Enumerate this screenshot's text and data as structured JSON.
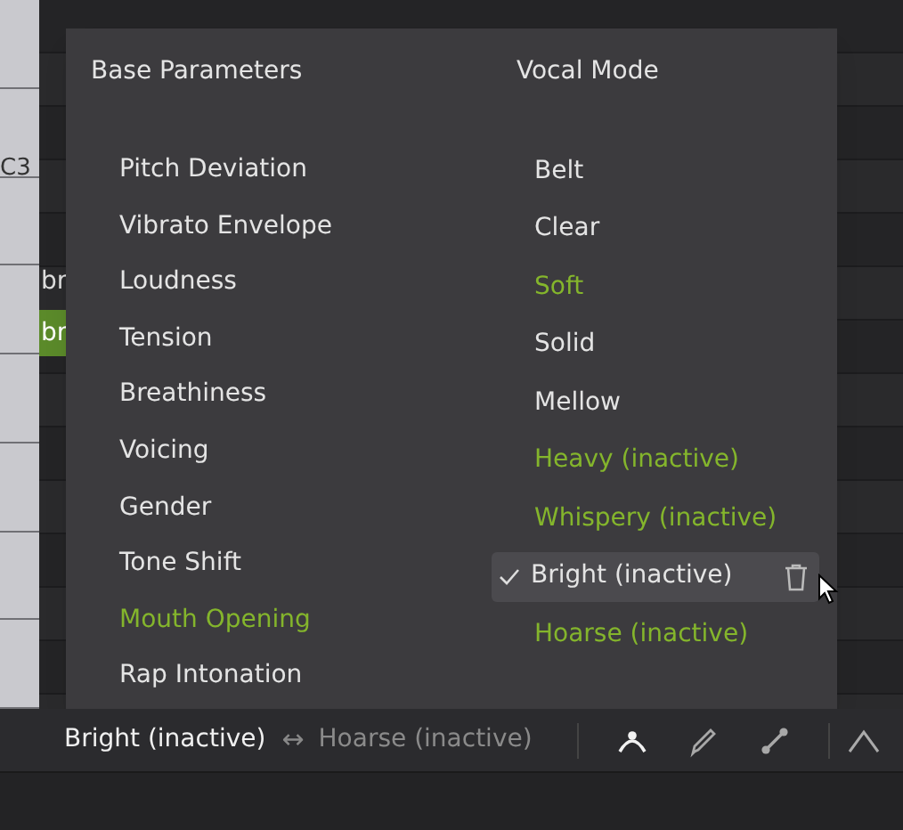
{
  "piano_roll": {
    "key_label": "C3",
    "notes": [
      {
        "lyric": "br",
        "selected": false
      },
      {
        "lyric": "br",
        "selected": true
      }
    ]
  },
  "menu": {
    "columns": [
      {
        "title": "Base Parameters",
        "items": [
          {
            "label": "Pitch Deviation",
            "highlighted": false,
            "checked": false
          },
          {
            "label": "Vibrato Envelope",
            "highlighted": false,
            "checked": false
          },
          {
            "label": "Loudness",
            "highlighted": false,
            "checked": false
          },
          {
            "label": "Tension",
            "highlighted": false,
            "checked": false
          },
          {
            "label": "Breathiness",
            "highlighted": false,
            "checked": false
          },
          {
            "label": "Voicing",
            "highlighted": false,
            "checked": false
          },
          {
            "label": "Gender",
            "highlighted": false,
            "checked": false
          },
          {
            "label": "Tone Shift",
            "highlighted": false,
            "checked": false
          },
          {
            "label": "Mouth Opening",
            "highlighted": true,
            "checked": false
          },
          {
            "label": "Rap Intonation",
            "highlighted": false,
            "checked": false
          }
        ]
      },
      {
        "title": "Vocal Mode",
        "items": [
          {
            "label": "Belt",
            "highlighted": false,
            "checked": false
          },
          {
            "label": "Clear",
            "highlighted": false,
            "checked": false
          },
          {
            "label": "Soft",
            "highlighted": true,
            "checked": false
          },
          {
            "label": "Solid",
            "highlighted": false,
            "checked": false
          },
          {
            "label": "Mellow",
            "highlighted": false,
            "checked": false
          },
          {
            "label": "Heavy (inactive)",
            "highlighted": true,
            "checked": false
          },
          {
            "label": "Whispery (inactive)",
            "highlighted": true,
            "checked": false
          },
          {
            "label": "Bright (inactive)",
            "highlighted": false,
            "checked": true
          },
          {
            "label": "Hoarse (inactive)",
            "highlighted": true,
            "checked": false
          }
        ]
      }
    ]
  },
  "toolbar": {
    "from": "Bright (inactive)",
    "arrow": "↔",
    "to": "Hoarse (inactive)",
    "tools": [
      {
        "kind": "curve",
        "selected": true
      },
      {
        "kind": "pencil",
        "selected": false
      },
      {
        "kind": "line",
        "selected": false
      }
    ],
    "collapse": {
      "kind": "caret"
    }
  }
}
